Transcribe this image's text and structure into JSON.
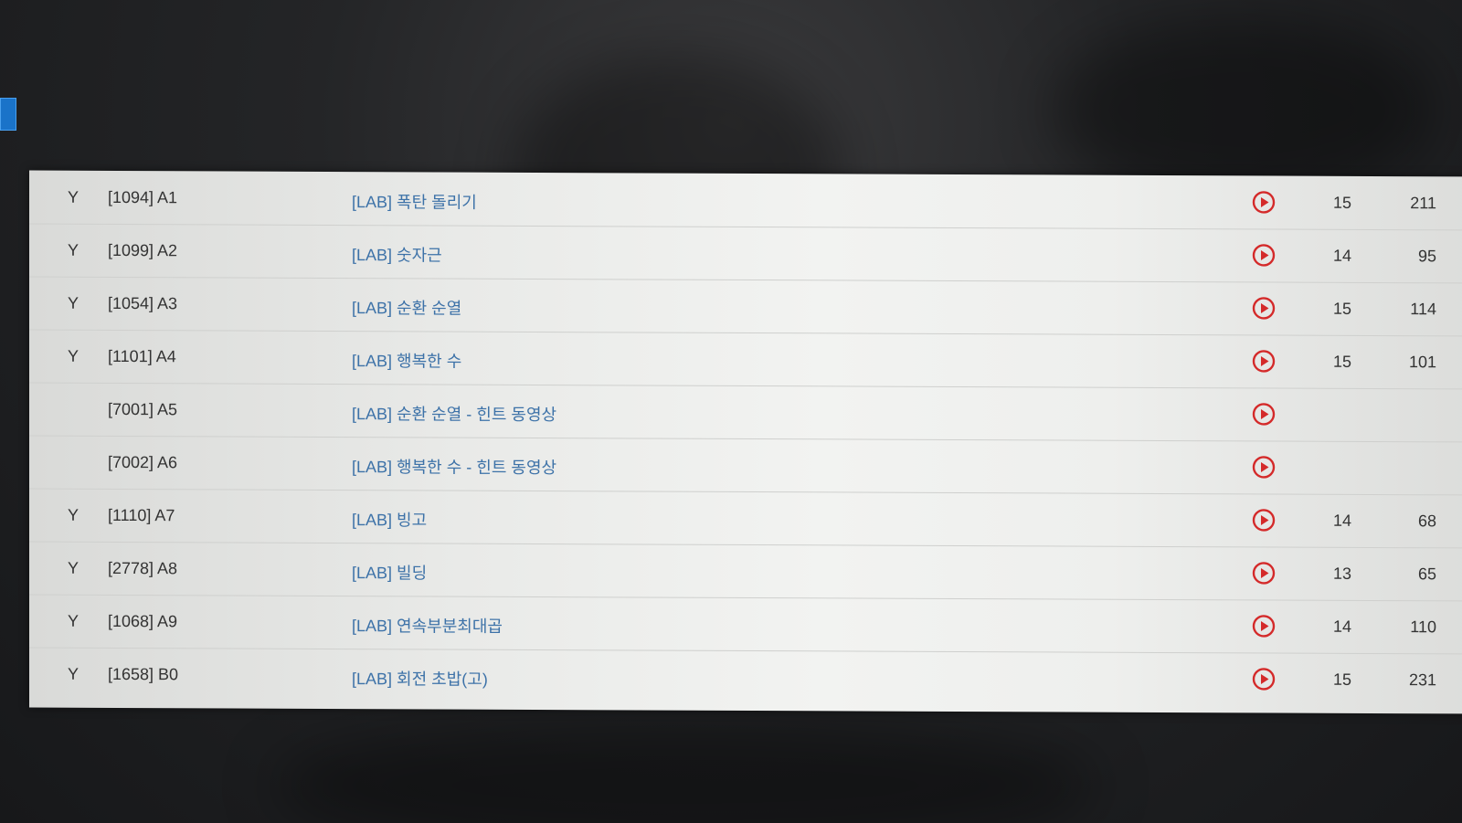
{
  "rows": [
    {
      "solved": "Y",
      "code": "[1094] A1",
      "title": "[LAB] 폭탄 돌리기",
      "count1": "15",
      "count2": "211"
    },
    {
      "solved": "Y",
      "code": "[1099] A2",
      "title": "[LAB] 숫자근",
      "count1": "14",
      "count2": "95"
    },
    {
      "solved": "Y",
      "code": "[1054] A3",
      "title": "[LAB] 순환 순열",
      "count1": "15",
      "count2": "114"
    },
    {
      "solved": "Y",
      "code": "[1101] A4",
      "title": "[LAB] 행복한 수",
      "count1": "15",
      "count2": "101"
    },
    {
      "solved": "",
      "code": "[7001] A5",
      "title": "[LAB] 순환 순열 - 힌트 동영상",
      "count1": "",
      "count2": ""
    },
    {
      "solved": "",
      "code": "[7002] A6",
      "title": "[LAB] 행복한 수 - 힌트 동영상",
      "count1": "",
      "count2": ""
    },
    {
      "solved": "Y",
      "code": "[1110] A7",
      "title": "[LAB] 빙고",
      "count1": "14",
      "count2": "68"
    },
    {
      "solved": "Y",
      "code": "[2778] A8",
      "title": "[LAB] 빌딩",
      "count1": "13",
      "count2": "65"
    },
    {
      "solved": "Y",
      "code": "[1068] A9",
      "title": "[LAB] 연속부분최대곱",
      "count1": "14",
      "count2": "110"
    },
    {
      "solved": "Y",
      "code": "[1658] B0",
      "title": "[LAB] 회전 초밥(고)",
      "count1": "15",
      "count2": "231"
    }
  ],
  "icons": {
    "play": "play-circle-icon"
  },
  "colors": {
    "title_link": "#3d72a8",
    "play_icon": "#d42a2a",
    "panel_bg": "#eeefed",
    "text": "#333333"
  }
}
